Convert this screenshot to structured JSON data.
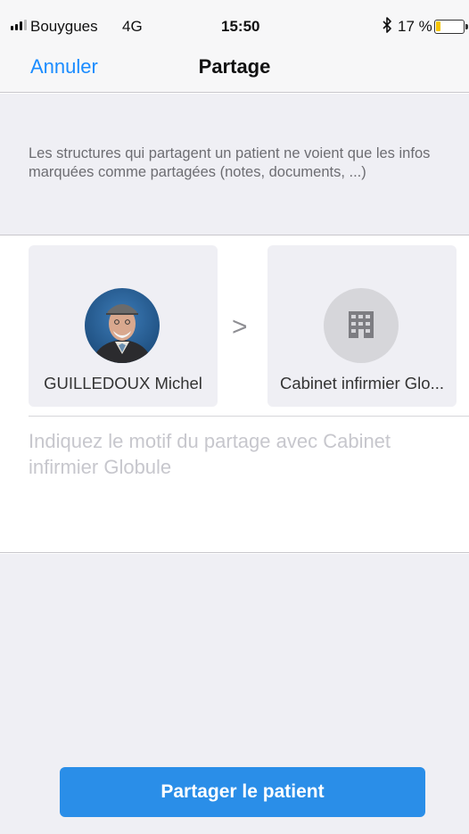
{
  "status_bar": {
    "carrier": "Bouygues",
    "network": "4G",
    "time": "15:50",
    "bluetooth_icon": "bluetooth-icon",
    "battery_percent": "17 %",
    "battery_level": 0.17,
    "battery_color": "#f5c400"
  },
  "nav": {
    "cancel_label": "Annuler",
    "title": "Partage"
  },
  "info": {
    "text": "Les structures qui partagent un patient ne voient que les infos marquées comme partagées (notes, documents, ...)"
  },
  "share": {
    "patient_name": "GUILLEDOUX Michel",
    "arrow": ">",
    "structure_name": "Cabinet infirmier Glo...",
    "structure_icon": "building-icon",
    "motif_placeholder": "Indiquez le motif du partage avec Cabinet infirmier Globule"
  },
  "actions": {
    "share_button_label": "Partager le patient"
  },
  "colors": {
    "accent": "#1a8cff",
    "button": "#2a8ee8"
  }
}
